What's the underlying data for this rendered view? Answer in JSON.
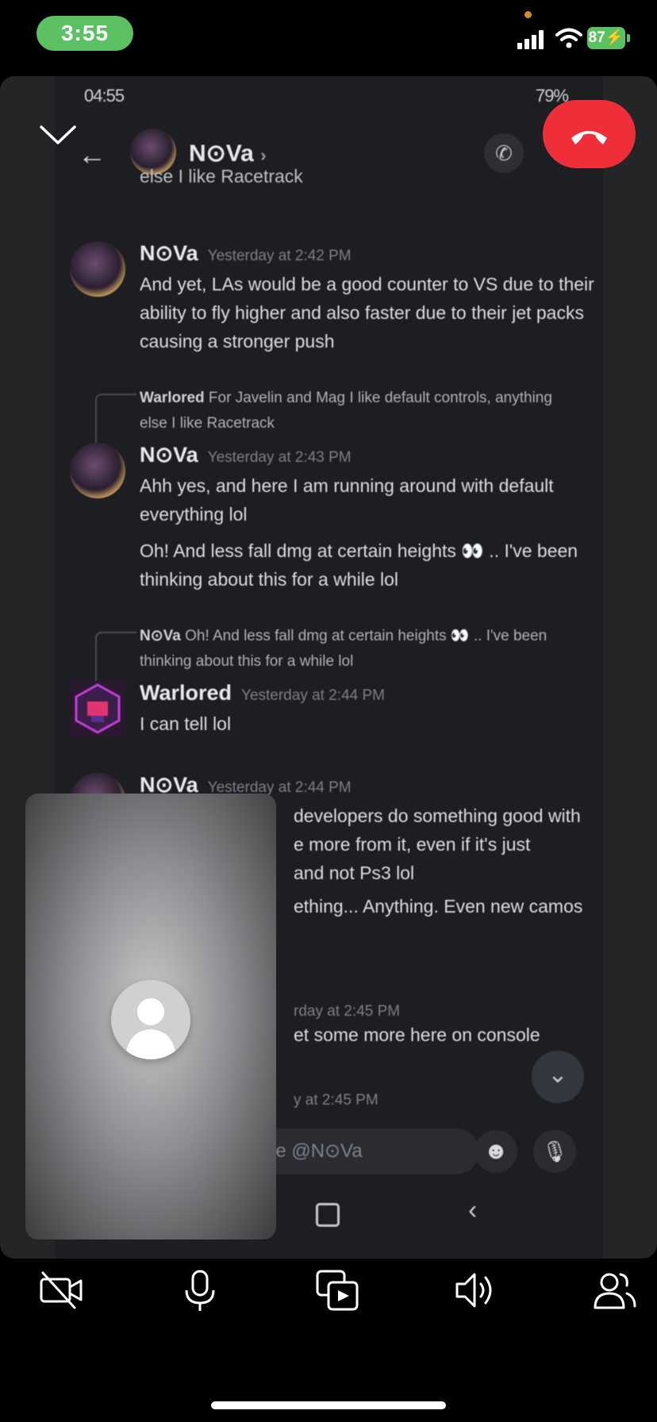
{
  "ios_status": {
    "time": "3:55",
    "battery": "87"
  },
  "android": {
    "status_time": "04:55",
    "status_battery": "79%",
    "header_name": "N⊙Va",
    "header_chevron": "›",
    "back_arrow": "←"
  },
  "messages": [
    {
      "type": "fragment",
      "text": "else I like Racetrack"
    },
    {
      "type": "message",
      "author": "N⊙Va",
      "time": "Yesterday at 2:42 PM",
      "text": "And yet, LAs would be a good counter to VS due to their ability to fly higher and also faster due to their jet packs causing a stronger push"
    },
    {
      "type": "reply",
      "author": "Warlored",
      "text": "For Javelin and Mag I like default controls, anything else I like Racetrack"
    },
    {
      "type": "message",
      "author": "N⊙Va",
      "time": "Yesterday at 2:43 PM",
      "text": "Ahh yes, and here I am running around with default everything lol",
      "text2": "Oh! And less fall dmg at certain heights 👀 .. I've been thinking about this for a while lol"
    },
    {
      "type": "reply",
      "author": "N⊙Va",
      "text": "Oh! And less fall dmg at certain heights 👀 .. I've been thinking about this for a while lol"
    },
    {
      "type": "message",
      "author": "Warlored",
      "time": "Yesterday at 2:44 PM",
      "text": "I can tell lol"
    },
    {
      "type": "message",
      "author": "N⊙Va",
      "time": "Yesterday at 2:44 PM",
      "text": "developers do something good with",
      "text2": "e more from it, even if it's just",
      "text3": "and not Ps3 lol",
      "text4": "ething... Anything. Even new camos"
    },
    {
      "type": "partial",
      "time": "rday at 2:45 PM",
      "text": "et some more here on console"
    },
    {
      "type": "partial",
      "time": "y at 2:45 PM"
    }
  ],
  "composer": {
    "placeholder": "ge @N⊙Va"
  },
  "icons": {
    "collapse": "chevron-down-icon",
    "end_call": "hang-up-icon",
    "camera_off": "video-off-icon",
    "mic": "microphone-icon",
    "share_screen": "screen-share-icon",
    "speaker": "speaker-icon",
    "participants": "people-icon"
  },
  "colors": {
    "end_call": "#ee2f3a",
    "time_pill": "#5cc162",
    "battery": "#59c15e"
  }
}
